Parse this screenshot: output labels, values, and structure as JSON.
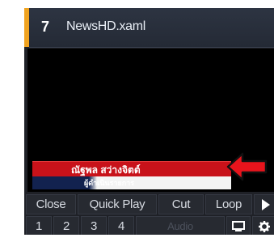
{
  "panel": {
    "channel_number": "7",
    "file_name": "NewsHD.xaml"
  },
  "lower_third": {
    "name_text": "ณัฐพล สว่างจิตต์",
    "role_text": "ผู้ดำเนินรายการ"
  },
  "controls": {
    "row1": {
      "close": "Close",
      "quick_play": "Quick Play",
      "cut": "Cut",
      "loop": "Loop"
    },
    "row2": {
      "layers": [
        "1",
        "2",
        "3",
        "4"
      ],
      "audio": "Audio"
    }
  },
  "icons": {
    "play": "play-icon",
    "monitor": "monitor-icon",
    "settings": "gear-icon"
  },
  "colors": {
    "accent": "#f0a320",
    "lower_third_red": "#c8121a",
    "lower_third_navy": "#12224f",
    "annotation_arrow": "#e8141c"
  }
}
